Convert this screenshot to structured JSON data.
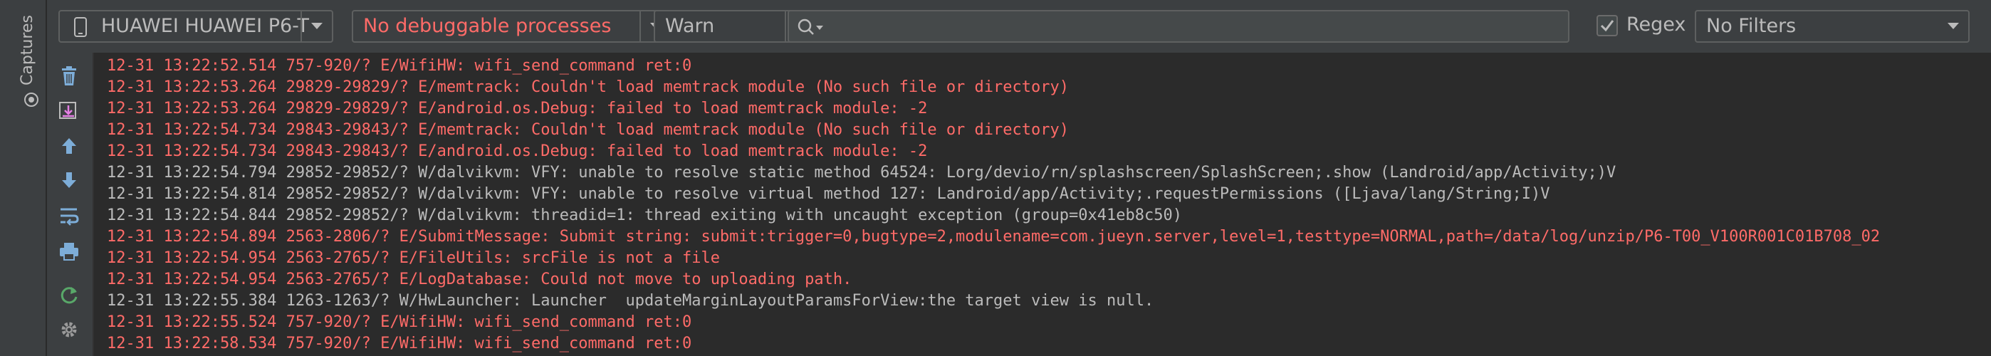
{
  "captures": {
    "label": "Captures",
    "icon": "camera-icon"
  },
  "toolbar": {
    "device": "HUAWEI HUAWEI P6-T",
    "process": "No debuggable processes",
    "log_level": "Warn",
    "search": {
      "value": "",
      "placeholder": ""
    },
    "regex": {
      "label": "Regex",
      "checked": true
    },
    "filter": "No Filters"
  },
  "side_actions": [
    {
      "name": "clear-logcat-icon"
    },
    {
      "name": "scroll-to-end-icon"
    },
    {
      "name": "up-stack-trace-icon"
    },
    {
      "name": "down-stack-trace-icon"
    },
    {
      "name": "soft-wraps-icon"
    },
    {
      "name": "print-icon"
    },
    {
      "name": "restart-icon"
    },
    {
      "name": "settings-icon"
    }
  ],
  "colors": {
    "error": "#ff6b68",
    "warn": "#bbbbbb",
    "background": "#2b2b2b",
    "toolbar": "#3c3f41"
  },
  "log_lines": [
    {
      "level": "E",
      "text": "12-31 13:22:52.514 757-920/? E/WifiHW: wifi_send_command ret:0"
    },
    {
      "level": "E",
      "text": "12-31 13:22:53.264 29829-29829/? E/memtrack: Couldn't load memtrack module (No such file or directory)"
    },
    {
      "level": "E",
      "text": "12-31 13:22:53.264 29829-29829/? E/android.os.Debug: failed to load memtrack module: -2"
    },
    {
      "level": "E",
      "text": "12-31 13:22:54.734 29843-29843/? E/memtrack: Couldn't load memtrack module (No such file or directory)"
    },
    {
      "level": "E",
      "text": "12-31 13:22:54.734 29843-29843/? E/android.os.Debug: failed to load memtrack module: -2"
    },
    {
      "level": "W",
      "text": "12-31 13:22:54.794 29852-29852/? W/dalvikvm: VFY: unable to resolve static method 64524: Lorg/devio/rn/splashscreen/SplashScreen;.show (Landroid/app/Activity;)V"
    },
    {
      "level": "W",
      "text": "12-31 13:22:54.814 29852-29852/? W/dalvikvm: VFY: unable to resolve virtual method 127: Landroid/app/Activity;.requestPermissions ([Ljava/lang/String;I)V"
    },
    {
      "level": "W",
      "text": "12-31 13:22:54.844 29852-29852/? W/dalvikvm: threadid=1: thread exiting with uncaught exception (group=0x41eb8c50)"
    },
    {
      "level": "E",
      "text": "12-31 13:22:54.894 2563-2806/? E/SubmitMessage: Submit string: submit:trigger=0,bugtype=2,modulename=com.jueyn.server,level=1,testtype=NORMAL,path=/data/log/unzip/P6-T00_V100R001C01B708_02"
    },
    {
      "level": "E",
      "text": "12-31 13:22:54.954 2563-2765/? E/FileUtils: srcFile is not a file"
    },
    {
      "level": "E",
      "text": "12-31 13:22:54.954 2563-2765/? E/LogDatabase: Could not move to uploading path."
    },
    {
      "level": "W",
      "text": "12-31 13:22:55.384 1263-1263/? W/HwLauncher: Launcher  updateMarginLayoutParamsForView:the target view is null."
    },
    {
      "level": "E",
      "text": "12-31 13:22:55.524 757-920/? E/WifiHW: wifi_send_command ret:0"
    },
    {
      "level": "E",
      "text": "12-31 13:22:58.534 757-920/? E/WifiHW: wifi_send_command ret:0"
    }
  ]
}
